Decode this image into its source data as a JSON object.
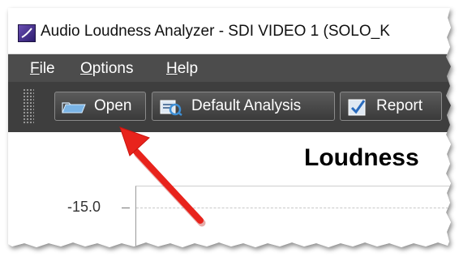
{
  "window": {
    "title": "Audio Loudness Analyzer - SDI VIDEO 1 (SOLO_K"
  },
  "menu": {
    "file_mnemonic": "F",
    "file_rest": "ile",
    "options_mnemonic": "O",
    "options_rest": "ptions",
    "help_mnemonic": "H",
    "help_rest": "elp"
  },
  "toolbar": {
    "open_label": "Open",
    "default_analysis_label": "Default Analysis",
    "report_label": "Report"
  },
  "chart": {
    "title": "Loudness",
    "y_tick": "-15.0"
  },
  "icons": {
    "app": "app-icon",
    "open": "folder-open-icon",
    "default_analysis": "analysis-icon",
    "report": "report-check-icon",
    "annotation": "red-arrow"
  },
  "colors": {
    "menubar": "#4c4c4c",
    "toolbar": "#3e3e3e",
    "arrow": "#e8231c"
  }
}
